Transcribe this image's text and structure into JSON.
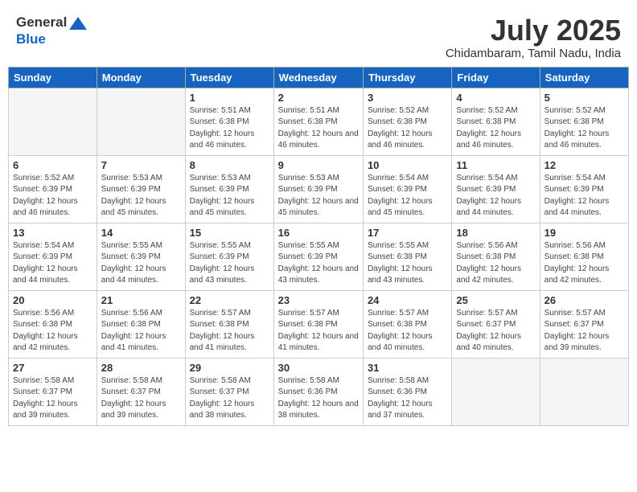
{
  "header": {
    "logo_general": "General",
    "logo_blue": "Blue",
    "month_title": "July 2025",
    "location": "Chidambaram, Tamil Nadu, India"
  },
  "weekdays": [
    "Sunday",
    "Monday",
    "Tuesday",
    "Wednesday",
    "Thursday",
    "Friday",
    "Saturday"
  ],
  "weeks": [
    [
      {
        "day": "",
        "sunrise": "",
        "sunset": "",
        "daylight": "",
        "empty": true
      },
      {
        "day": "",
        "sunrise": "",
        "sunset": "",
        "daylight": "",
        "empty": true
      },
      {
        "day": "1",
        "sunrise": "Sunrise: 5:51 AM",
        "sunset": "Sunset: 6:38 PM",
        "daylight": "Daylight: 12 hours and 46 minutes."
      },
      {
        "day": "2",
        "sunrise": "Sunrise: 5:51 AM",
        "sunset": "Sunset: 6:38 PM",
        "daylight": "Daylight: 12 hours and 46 minutes."
      },
      {
        "day": "3",
        "sunrise": "Sunrise: 5:52 AM",
        "sunset": "Sunset: 6:38 PM",
        "daylight": "Daylight: 12 hours and 46 minutes."
      },
      {
        "day": "4",
        "sunrise": "Sunrise: 5:52 AM",
        "sunset": "Sunset: 6:38 PM",
        "daylight": "Daylight: 12 hours and 46 minutes."
      },
      {
        "day": "5",
        "sunrise": "Sunrise: 5:52 AM",
        "sunset": "Sunset: 6:38 PM",
        "daylight": "Daylight: 12 hours and 46 minutes."
      }
    ],
    [
      {
        "day": "6",
        "sunrise": "Sunrise: 5:52 AM",
        "sunset": "Sunset: 6:39 PM",
        "daylight": "Daylight: 12 hours and 46 minutes."
      },
      {
        "day": "7",
        "sunrise": "Sunrise: 5:53 AM",
        "sunset": "Sunset: 6:39 PM",
        "daylight": "Daylight: 12 hours and 45 minutes."
      },
      {
        "day": "8",
        "sunrise": "Sunrise: 5:53 AM",
        "sunset": "Sunset: 6:39 PM",
        "daylight": "Daylight: 12 hours and 45 minutes."
      },
      {
        "day": "9",
        "sunrise": "Sunrise: 5:53 AM",
        "sunset": "Sunset: 6:39 PM",
        "daylight": "Daylight: 12 hours and 45 minutes."
      },
      {
        "day": "10",
        "sunrise": "Sunrise: 5:54 AM",
        "sunset": "Sunset: 6:39 PM",
        "daylight": "Daylight: 12 hours and 45 minutes."
      },
      {
        "day": "11",
        "sunrise": "Sunrise: 5:54 AM",
        "sunset": "Sunset: 6:39 PM",
        "daylight": "Daylight: 12 hours and 44 minutes."
      },
      {
        "day": "12",
        "sunrise": "Sunrise: 5:54 AM",
        "sunset": "Sunset: 6:39 PM",
        "daylight": "Daylight: 12 hours and 44 minutes."
      }
    ],
    [
      {
        "day": "13",
        "sunrise": "Sunrise: 5:54 AM",
        "sunset": "Sunset: 6:39 PM",
        "daylight": "Daylight: 12 hours and 44 minutes."
      },
      {
        "day": "14",
        "sunrise": "Sunrise: 5:55 AM",
        "sunset": "Sunset: 6:39 PM",
        "daylight": "Daylight: 12 hours and 44 minutes."
      },
      {
        "day": "15",
        "sunrise": "Sunrise: 5:55 AM",
        "sunset": "Sunset: 6:39 PM",
        "daylight": "Daylight: 12 hours and 43 minutes."
      },
      {
        "day": "16",
        "sunrise": "Sunrise: 5:55 AM",
        "sunset": "Sunset: 6:39 PM",
        "daylight": "Daylight: 12 hours and 43 minutes."
      },
      {
        "day": "17",
        "sunrise": "Sunrise: 5:55 AM",
        "sunset": "Sunset: 6:38 PM",
        "daylight": "Daylight: 12 hours and 43 minutes."
      },
      {
        "day": "18",
        "sunrise": "Sunrise: 5:56 AM",
        "sunset": "Sunset: 6:38 PM",
        "daylight": "Daylight: 12 hours and 42 minutes."
      },
      {
        "day": "19",
        "sunrise": "Sunrise: 5:56 AM",
        "sunset": "Sunset: 6:38 PM",
        "daylight": "Daylight: 12 hours and 42 minutes."
      }
    ],
    [
      {
        "day": "20",
        "sunrise": "Sunrise: 5:56 AM",
        "sunset": "Sunset: 6:38 PM",
        "daylight": "Daylight: 12 hours and 42 minutes."
      },
      {
        "day": "21",
        "sunrise": "Sunrise: 5:56 AM",
        "sunset": "Sunset: 6:38 PM",
        "daylight": "Daylight: 12 hours and 41 minutes."
      },
      {
        "day": "22",
        "sunrise": "Sunrise: 5:57 AM",
        "sunset": "Sunset: 6:38 PM",
        "daylight": "Daylight: 12 hours and 41 minutes."
      },
      {
        "day": "23",
        "sunrise": "Sunrise: 5:57 AM",
        "sunset": "Sunset: 6:38 PM",
        "daylight": "Daylight: 12 hours and 41 minutes."
      },
      {
        "day": "24",
        "sunrise": "Sunrise: 5:57 AM",
        "sunset": "Sunset: 6:38 PM",
        "daylight": "Daylight: 12 hours and 40 minutes."
      },
      {
        "day": "25",
        "sunrise": "Sunrise: 5:57 AM",
        "sunset": "Sunset: 6:37 PM",
        "daylight": "Daylight: 12 hours and 40 minutes."
      },
      {
        "day": "26",
        "sunrise": "Sunrise: 5:57 AM",
        "sunset": "Sunset: 6:37 PM",
        "daylight": "Daylight: 12 hours and 39 minutes."
      }
    ],
    [
      {
        "day": "27",
        "sunrise": "Sunrise: 5:58 AM",
        "sunset": "Sunset: 6:37 PM",
        "daylight": "Daylight: 12 hours and 39 minutes."
      },
      {
        "day": "28",
        "sunrise": "Sunrise: 5:58 AM",
        "sunset": "Sunset: 6:37 PM",
        "daylight": "Daylight: 12 hours and 39 minutes."
      },
      {
        "day": "29",
        "sunrise": "Sunrise: 5:58 AM",
        "sunset": "Sunset: 6:37 PM",
        "daylight": "Daylight: 12 hours and 38 minutes."
      },
      {
        "day": "30",
        "sunrise": "Sunrise: 5:58 AM",
        "sunset": "Sunset: 6:36 PM",
        "daylight": "Daylight: 12 hours and 38 minutes."
      },
      {
        "day": "31",
        "sunrise": "Sunrise: 5:58 AM",
        "sunset": "Sunset: 6:36 PM",
        "daylight": "Daylight: 12 hours and 37 minutes."
      },
      {
        "day": "",
        "sunrise": "",
        "sunset": "",
        "daylight": "",
        "empty": true
      },
      {
        "day": "",
        "sunrise": "",
        "sunset": "",
        "daylight": "",
        "empty": true
      }
    ]
  ]
}
